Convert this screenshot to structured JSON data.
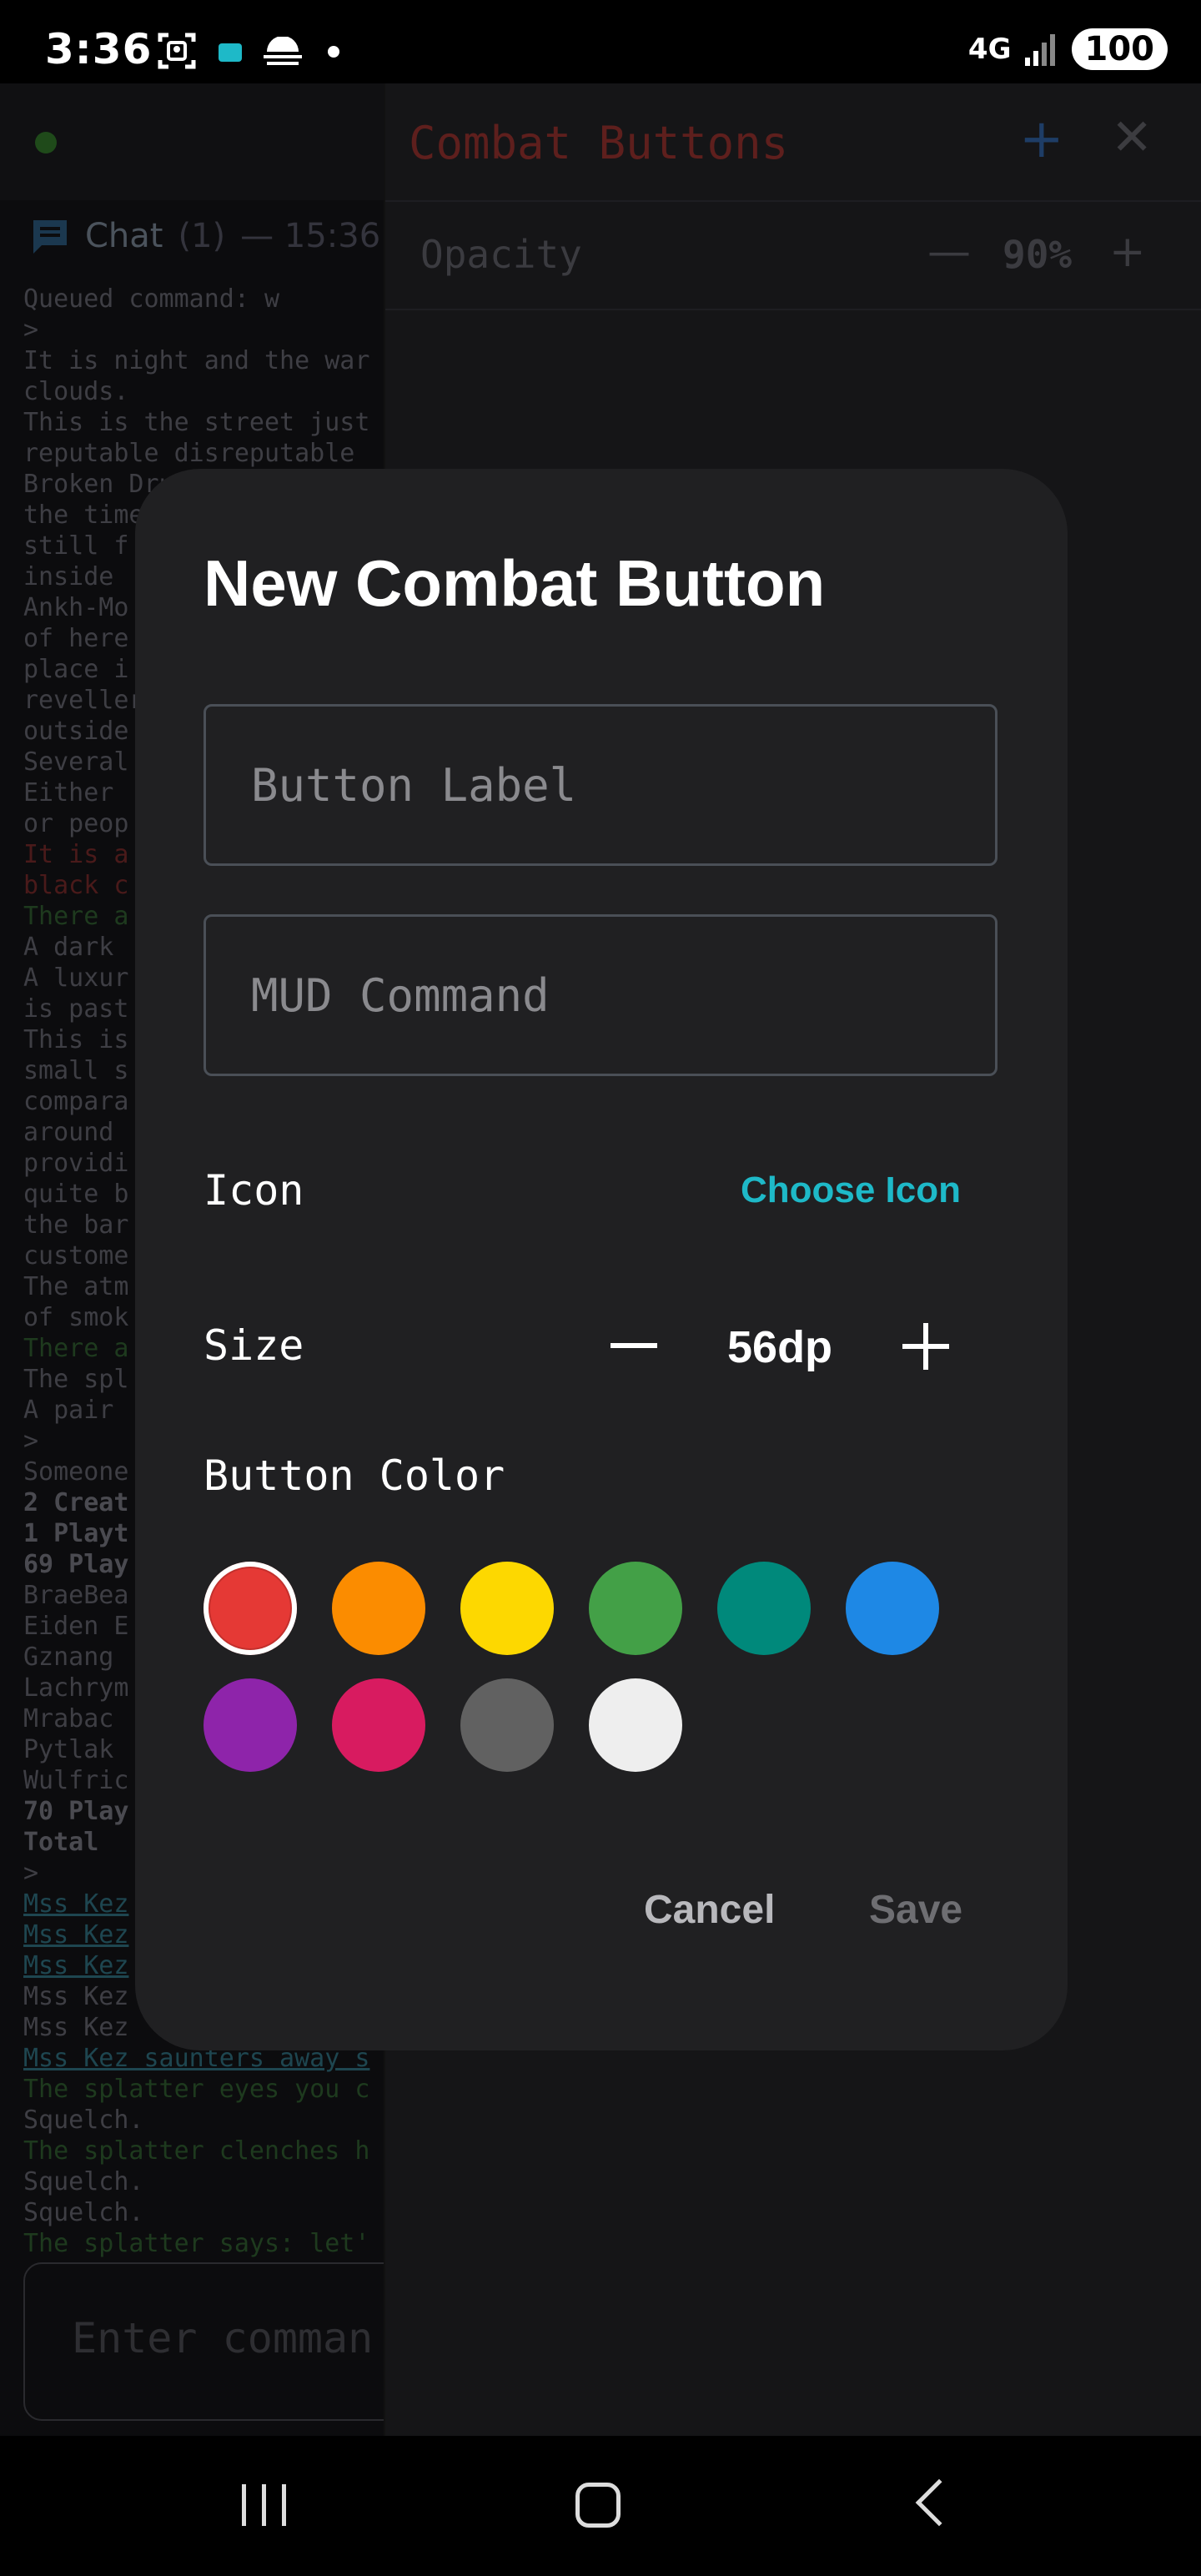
{
  "status_bar": {
    "time": "3:36",
    "network": "4G",
    "battery": "100"
  },
  "chat": {
    "title": "Chat",
    "count": "(1)",
    "time": "— 15:36"
  },
  "terminal_lines": [
    {
      "text": "Queued command: w",
      "style": ""
    },
    {
      "text": ">",
      "style": ""
    },
    {
      "text": "It is night and the war",
      "style": ""
    },
    {
      "text": "clouds.",
      "style": ""
    },
    {
      "text": "This is the street just",
      "style": ""
    },
    {
      "text": "reputable disreputable",
      "style": ""
    },
    {
      "text": "Broken Drum, which",
      "style": ""
    },
    {
      "text": "the time",
      "style": ""
    },
    {
      "text": "still f",
      "style": ""
    },
    {
      "text": "inside",
      "style": ""
    },
    {
      "text": "Ankh-Mo",
      "style": ""
    },
    {
      "text": "of here",
      "style": ""
    },
    {
      "text": "place i",
      "style": ""
    },
    {
      "text": "reveller",
      "style": ""
    },
    {
      "text": "outside",
      "style": ""
    },
    {
      "text": "Several",
      "style": ""
    },
    {
      "text": "Either",
      "style": ""
    },
    {
      "text": "or peop",
      "style": ""
    },
    {
      "text": "It is a",
      "style": "red"
    },
    {
      "text": "black c",
      "style": "red"
    },
    {
      "text": "There a",
      "style": "green"
    },
    {
      "text": "A dark",
      "style": ""
    },
    {
      "text": "A luxur",
      "style": ""
    },
    {
      "text": "is past",
      "style": ""
    },
    {
      "text": "This is",
      "style": ""
    },
    {
      "text": "small s",
      "style": ""
    },
    {
      "text": "compara",
      "style": ""
    },
    {
      "text": "around",
      "style": ""
    },
    {
      "text": "providi",
      "style": ""
    },
    {
      "text": "quite b",
      "style": ""
    },
    {
      "text": "the bar",
      "style": ""
    },
    {
      "text": "custome",
      "style": ""
    },
    {
      "text": "The atm",
      "style": ""
    },
    {
      "text": "of smok",
      "style": ""
    },
    {
      "text": "There a",
      "style": "green"
    },
    {
      "text": "The spl",
      "style": ""
    },
    {
      "text": "A pair",
      "style": ""
    },
    {
      "text": ">",
      "style": ""
    },
    {
      "text": "Someone",
      "style": ""
    },
    {
      "text": "2 Creat",
      "style": "bold"
    },
    {
      "text": "1 Playt",
      "style": "bold"
    },
    {
      "text": "69 Play",
      "style": "bold"
    },
    {
      "text": "BraeBea",
      "style": ""
    },
    {
      "text": "Eiden E",
      "style": ""
    },
    {
      "text": "Gznang",
      "style": ""
    },
    {
      "text": "Lachrym",
      "style": ""
    },
    {
      "text": "Mrabac",
      "style": ""
    },
    {
      "text": "Pytlak",
      "style": ""
    },
    {
      "text": "Wulfric",
      "style": ""
    },
    {
      "text": "70 Play",
      "style": "bold"
    },
    {
      "text": "Total",
      "style": "bold"
    },
    {
      "text": ">",
      "style": ""
    },
    {
      "text": "Mss Kez",
      "style": "link"
    },
    {
      "text": "Mss Kez",
      "style": "link"
    },
    {
      "text": "Mss Kez",
      "style": "link"
    },
    {
      "text": "Mss Kez",
      "style": ""
    },
    {
      "text": "Mss Kez",
      "style": ""
    },
    {
      "text": "Mss Kez saunters away s",
      "style": "link"
    },
    {
      "text": "The splatter eyes you c",
      "style": "green"
    },
    {
      "text": "Squelch.",
      "style": ""
    },
    {
      "text": "The splatter clenches h",
      "style": "green"
    },
    {
      "text": "Squelch.",
      "style": ""
    },
    {
      "text": "Squelch.",
      "style": ""
    },
    {
      "text": "The splatter says: let'",
      "style": "green"
    }
  ],
  "command_input": {
    "placeholder": "Enter comman"
  },
  "side_panel": {
    "title": "Combat Buttons",
    "add_label": "+",
    "close_label": "✕",
    "opacity_label": "Opacity",
    "opacity_minus": "—",
    "opacity_value": "90%",
    "opacity_plus": "+"
  },
  "dialog": {
    "title": "New Combat Button",
    "label_field": {
      "placeholder": "Button Label",
      "value": ""
    },
    "command_field": {
      "placeholder": "MUD Command",
      "value": ""
    },
    "icon_label": "Icon",
    "choose_icon_label": "Choose Icon",
    "size_label": "Size",
    "size_value": "56dp",
    "color_label": "Button Color",
    "colors": [
      {
        "name": "red",
        "hex": "#e53935",
        "selected": true
      },
      {
        "name": "orange",
        "hex": "#fb8c00",
        "selected": false
      },
      {
        "name": "yellow",
        "hex": "#fdd800",
        "selected": false
      },
      {
        "name": "green",
        "hex": "#43a047",
        "selected": false
      },
      {
        "name": "teal",
        "hex": "#00897b",
        "selected": false
      },
      {
        "name": "blue",
        "hex": "#1e88e5",
        "selected": false
      },
      {
        "name": "purple",
        "hex": "#8e24aa",
        "selected": false
      },
      {
        "name": "pink",
        "hex": "#d81b60",
        "selected": false
      },
      {
        "name": "gray",
        "hex": "#616161",
        "selected": false
      },
      {
        "name": "white",
        "hex": "#eeeeee",
        "selected": false
      }
    ],
    "cancel_label": "Cancel",
    "save_label": "Save"
  },
  "accent_color": "#1eb9c8"
}
